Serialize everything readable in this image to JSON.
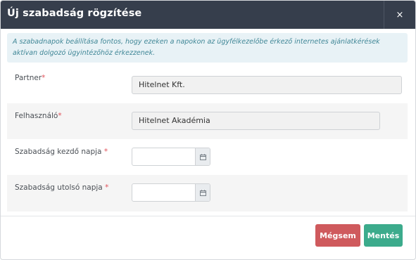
{
  "modal": {
    "title": "Új szabadság rögzítése",
    "close_glyph": "×"
  },
  "info": {
    "text": "A szabadnapok beállítása fontos, hogy ezeken a napokon az ügyfélkezelőbe érkező internetes ajánlatkérések aktívan dolgozó ügyintézőhöz érkezzenek."
  },
  "form": {
    "partner": {
      "label": "Partner",
      "required_mark": "*",
      "value": "Hitelnet Kft."
    },
    "user": {
      "label": "Felhasználó",
      "required_mark": "*",
      "value": "Hitelnet Akadémia"
    },
    "start_date": {
      "label": "Szabadság kezdő napja ",
      "required_mark": "*",
      "value": "",
      "icon": "calendar-icon"
    },
    "end_date": {
      "label": "Szabadság utolsó napja ",
      "required_mark": "*",
      "value": "",
      "icon": "calendar-icon"
    }
  },
  "footer": {
    "cancel_label": "Mégsem",
    "save_label": "Mentés"
  },
  "colors": {
    "header_bg": "#363e4c",
    "info_bg": "#e8f2f6",
    "info_text": "#3f8696",
    "required": "#e0525b",
    "cancel": "#cf5a5d",
    "save": "#3cab8c"
  }
}
